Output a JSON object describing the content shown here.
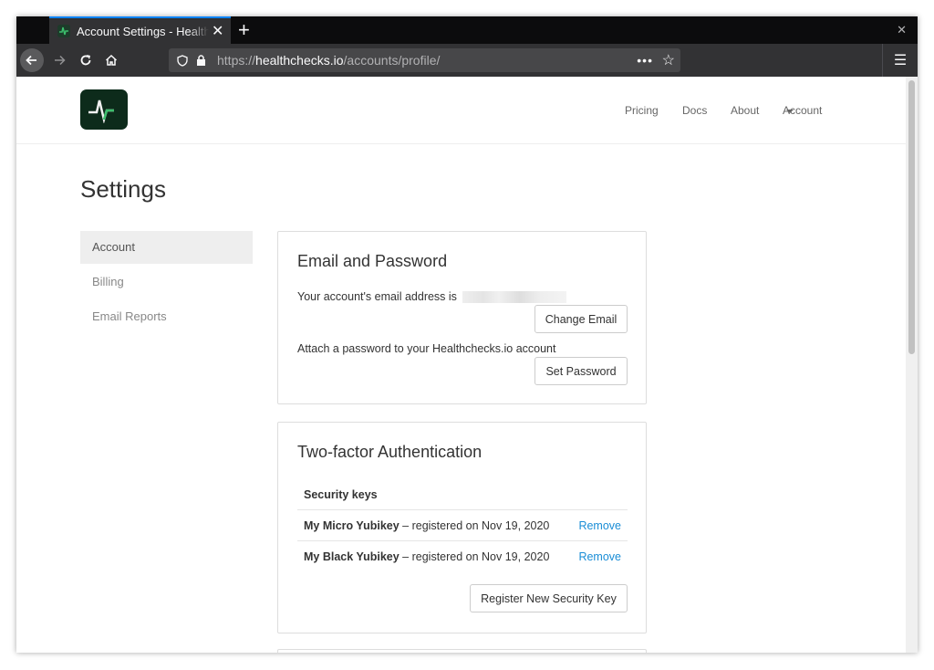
{
  "browser": {
    "tab_title": "Account Settings - Healthchecks.io",
    "tab_close": "✕",
    "new_tab": "+",
    "window_close": "✕",
    "url_prefix": "https://",
    "url_domain": "healthchecks.io",
    "url_path": "/accounts/profile/",
    "page_actions": "•••"
  },
  "nav": {
    "links": [
      "Pricing",
      "Docs",
      "About"
    ],
    "account": "Account"
  },
  "page": {
    "title": "Settings"
  },
  "sidebar": {
    "items": [
      {
        "label": "Account",
        "active": true
      },
      {
        "label": "Billing",
        "active": false
      },
      {
        "label": "Email Reports",
        "active": false
      }
    ]
  },
  "email_panel": {
    "heading": "Email and Password",
    "email_text": "Your account's email address is",
    "change_email_button": "Change Email",
    "password_text": "Attach a password to your Healthchecks.io account",
    "set_password_button": "Set Password"
  },
  "twofa_panel": {
    "heading": "Two-factor Authentication",
    "table_header": "Security keys",
    "keys": [
      {
        "name": "My Micro Yubikey",
        "registered": "– registered on Nov 19, 2020",
        "action": "Remove"
      },
      {
        "name": "My Black Yubikey",
        "registered": "– registered on Nov 19, 2020",
        "action": "Remove"
      }
    ],
    "register_button": "Register New Security Key"
  },
  "colors": {
    "accent_link": "#1a8dd6",
    "tab_highlight": "#0a84ff",
    "logo_bg": "#0d2b1b",
    "logo_line": "#3cbe6c"
  }
}
